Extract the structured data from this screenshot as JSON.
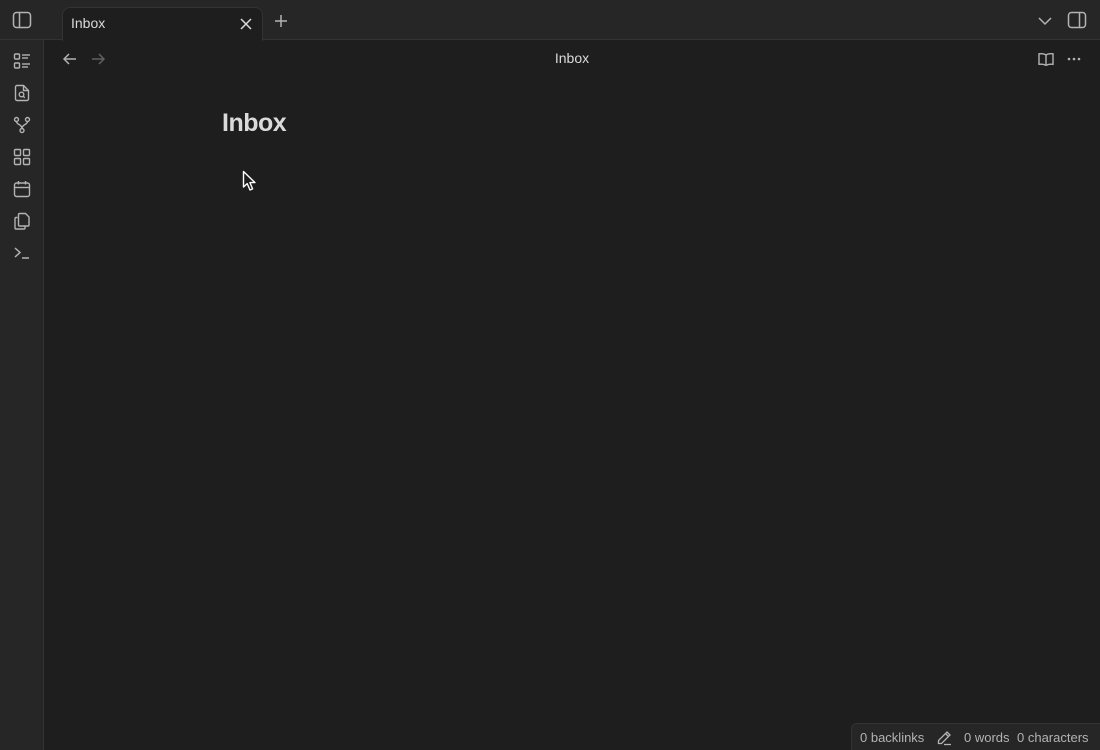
{
  "tabs": [
    {
      "label": "Inbox",
      "active": true
    }
  ],
  "view": {
    "title": "Inbox"
  },
  "note": {
    "title": "Inbox"
  },
  "statusbar": {
    "backlinks": "0 backlinks",
    "words": "0 words",
    "characters": "0 characters"
  },
  "ribbon": {
    "icons": [
      "list-icon",
      "file-search-icon",
      "graph-icon",
      "grid-icon",
      "calendar-icon",
      "copy-icon",
      "terminal-icon"
    ]
  },
  "colors": {
    "background": "#1e1e1e",
    "chrome": "#262626",
    "border": "#333333",
    "text": "#dadada",
    "muted": "#b3b3b3"
  }
}
